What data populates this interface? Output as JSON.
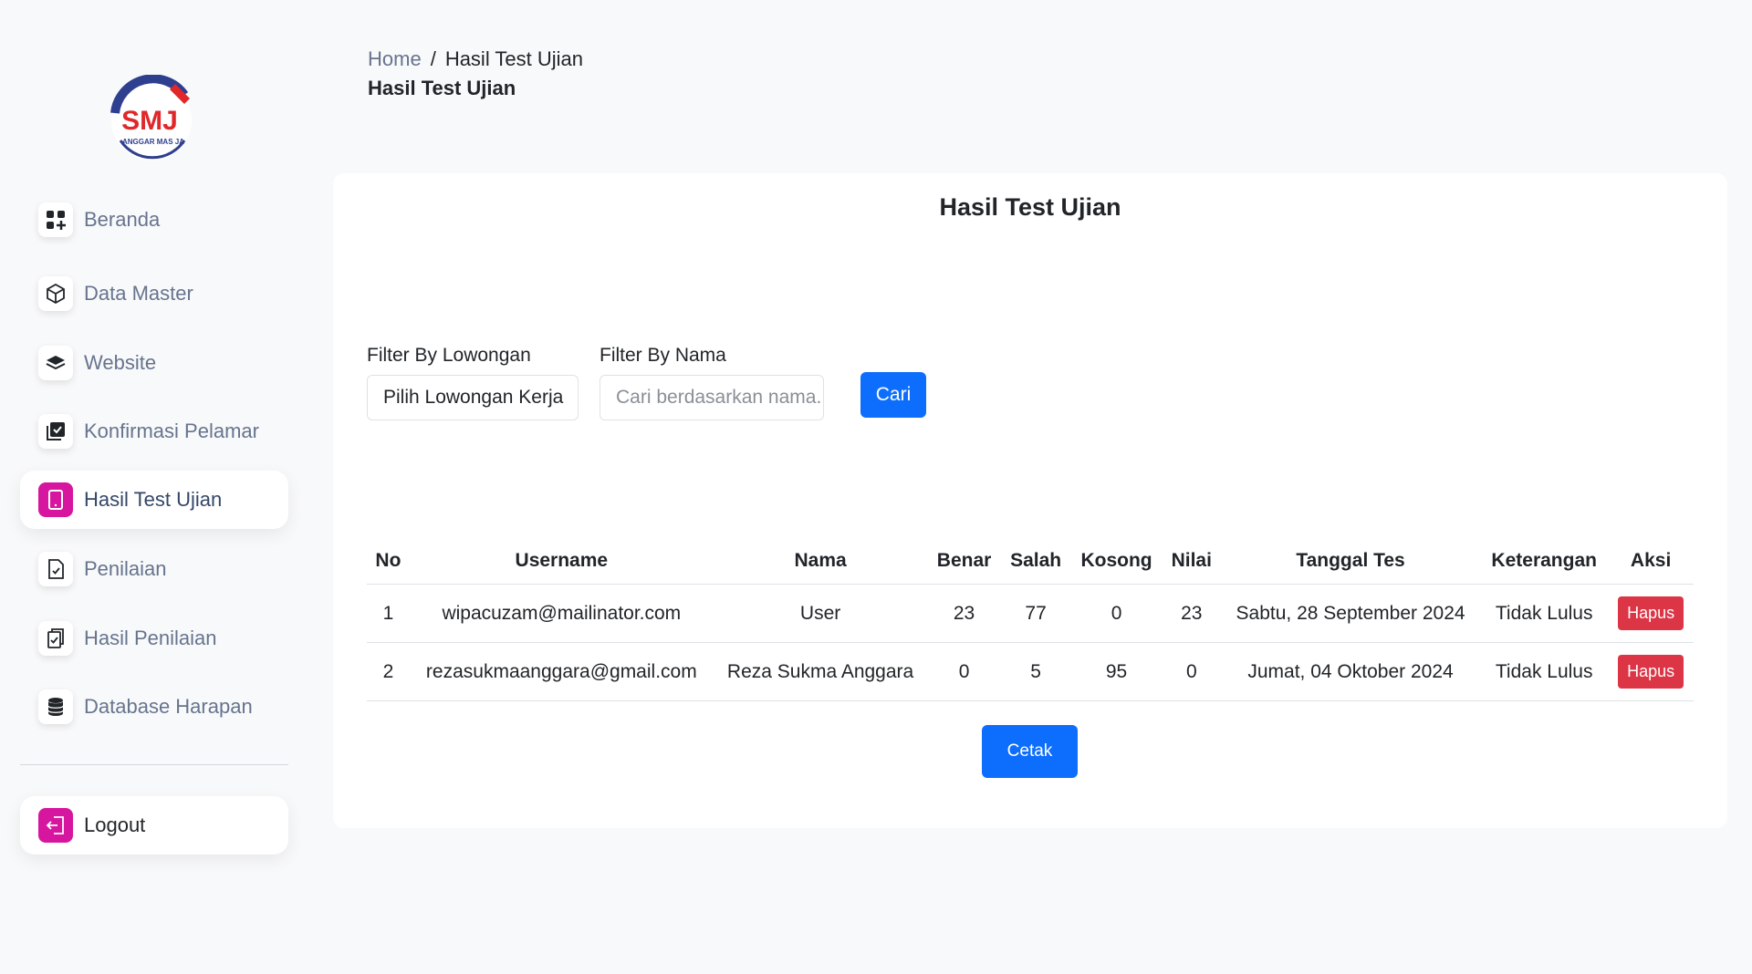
{
  "brand": {
    "logo_text": "SMJ",
    "logo_subtext": "ANGGAR MAS JA"
  },
  "sidebar": {
    "items": [
      {
        "label": "Beranda",
        "icon": "grid-plus-icon"
      },
      {
        "label": "Data Master",
        "icon": "box-icon"
      },
      {
        "label": "Website",
        "icon": "layers-icon"
      },
      {
        "label": "Konfirmasi Pelamar",
        "icon": "check-stack-icon"
      },
      {
        "label": "Hasil Test Ujian",
        "icon": "tablet-icon",
        "active": true
      },
      {
        "label": "Penilaian",
        "icon": "file-check-icon"
      },
      {
        "label": "Hasil Penilaian",
        "icon": "clipboard-check-icon"
      },
      {
        "label": "Database Harapan",
        "icon": "database-icon"
      }
    ],
    "logout_label": "Logout"
  },
  "header": {
    "breadcrumb_home": "Home",
    "breadcrumb_sep": "/",
    "breadcrumb_current": "Hasil Test Ujian",
    "title": "Hasil Test Ujian"
  },
  "card": {
    "title": "Hasil Test Ujian",
    "filter_lowongan_label": "Filter By Lowongan",
    "filter_lowongan_value": "Pilih Lowongan Kerja",
    "filter_nama_label": "Filter By Nama",
    "search_placeholder": "Cari berdasarkan nama...",
    "search_value": "",
    "cari_label": "Cari",
    "cetak_label": "Cetak"
  },
  "table": {
    "headers": [
      "No",
      "Username",
      "Nama",
      "Benar",
      "Salah",
      "Kosong",
      "Nilai",
      "Tanggal Tes",
      "Keterangan",
      "Aksi"
    ],
    "rows": [
      {
        "no": "1",
        "username": "wipacuzam@mailinator.com",
        "nama": "User",
        "benar": "23",
        "salah": "77",
        "kosong": "0",
        "nilai": "23",
        "tanggal": "Sabtu, 28 September 2024",
        "keterangan": "Tidak Lulus",
        "aksi": "Hapus"
      },
      {
        "no": "2",
        "username": "rezasukmaanggara@gmail.com",
        "nama": "Reza Sukma Anggara",
        "benar": "0",
        "salah": "5",
        "kosong": "95",
        "nilai": "0",
        "tanggal": "Jumat, 04 Oktober 2024",
        "keterangan": "Tidak Lulus",
        "aksi": "Hapus"
      }
    ]
  },
  "colors": {
    "primary": "#0d6efd",
    "danger": "#dc3545",
    "accent": "#d6169f"
  }
}
